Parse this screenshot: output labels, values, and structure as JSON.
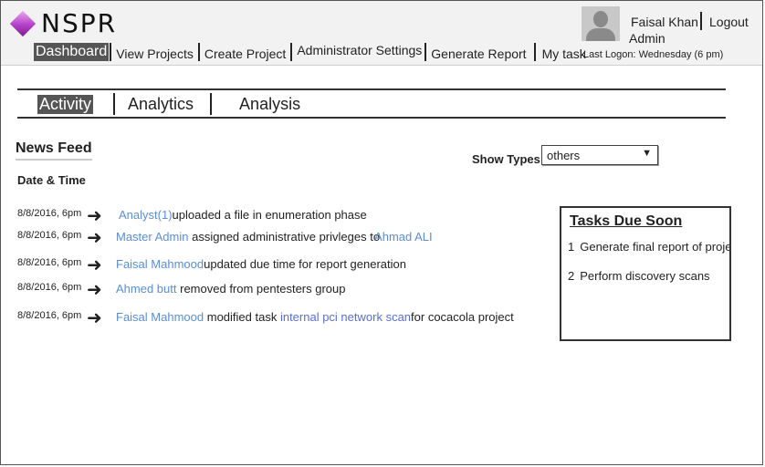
{
  "app": {
    "brand": "NSPR"
  },
  "nav": {
    "items": [
      {
        "label": "Dashboard",
        "active": true
      },
      {
        "label": "View Projects"
      },
      {
        "label": "Create Project"
      },
      {
        "label": "Administrator Settings"
      },
      {
        "label": "Generate Report"
      },
      {
        "label": "My task"
      }
    ]
  },
  "user": {
    "name": "Faisal Khan",
    "logout_label": "Logout",
    "role": "Admin",
    "last_logon_label": "Last Logon:",
    "last_logon_value": "Wednesday (6 pm)"
  },
  "tabs": [
    {
      "label": "Activity",
      "active": true
    },
    {
      "label": "Analytics"
    },
    {
      "label": "Analysis"
    }
  ],
  "news_feed": {
    "title": "News Feed",
    "date_label": "Date & Time",
    "show_types_label": "Show Types",
    "show_types_value": "others",
    "rows": [
      {
        "date": "8/8/2016, 6pm",
        "actor": "Analyst(1)",
        "action": "uploaded a file in enumeration phase"
      },
      {
        "date": "8/8/2016, 6pm",
        "actor": "Master Admin",
        "action": "assigned administrative privleges to",
        "target": "Ahmad ALI"
      },
      {
        "date": "8/8/2016, 6pm",
        "actor": "Faisal Mahmood",
        "action": "updated due time for report generation"
      },
      {
        "date": "8/8/2016, 6pm",
        "actor": "Ahmed butt",
        "action": "removed from pentesters group"
      },
      {
        "date": "8/8/2016, 6pm",
        "actor": "Faisal Mahmood",
        "action": "modified task",
        "task": "internal pci network scan",
        "suffix": "for cocacola project"
      }
    ]
  },
  "tasks_due": {
    "title": "Tasks Due Soon",
    "items": [
      {
        "num": "1",
        "label": "Generate final report of project x"
      },
      {
        "num": "2",
        "label": "Perform discovery scans"
      }
    ]
  },
  "colors": {
    "link": "#5b8ed6",
    "active_bg": "#555555",
    "header_bg": "#f2f2f2"
  },
  "icons": {
    "logo": "diamond-logo-icon",
    "arrow": "arrow-right-icon",
    "avatar": "user-avatar-icon"
  }
}
